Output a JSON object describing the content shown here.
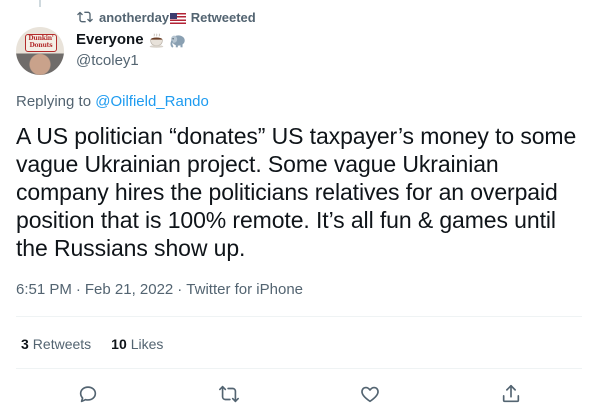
{
  "retweet": {
    "user": "anotherday",
    "label": "Retweeted",
    "icon": "retweet-icon"
  },
  "author": {
    "name": "Everyone",
    "handle": "@tcoley1",
    "emojis": [
      "coffee-icon",
      "elephant-icon"
    ],
    "avatar_sign_text": "Dunkin' Donuts",
    "flag_icon": "us-flag-icon"
  },
  "replying": {
    "prefix": "Replying to",
    "to": "@Oilfield_Rando"
  },
  "tweet": {
    "text": "A US politician “donates” US taxpayer’s money to some vague Ukrainian project. Some vague Ukrainian company hires the politicians relatives for an overpaid position that is 100% remote. It’s all fun & games until the Russians show up."
  },
  "meta": {
    "time": "6:51 PM",
    "sep1": "·",
    "date": "Feb 21, 2022",
    "sep2": "·",
    "source": "Twitter for iPhone"
  },
  "stats": {
    "retweets_count": "3",
    "retweets_label": "Retweets",
    "likes_count": "10",
    "likes_label": "Likes"
  },
  "actions": [
    "reply-icon",
    "retweet-icon",
    "like-icon",
    "share-icon"
  ],
  "colors": {
    "accent": "#1d9bf0",
    "secondary_text": "#536471",
    "primary_text": "#0f1419",
    "divider": "#eff3f4"
  }
}
